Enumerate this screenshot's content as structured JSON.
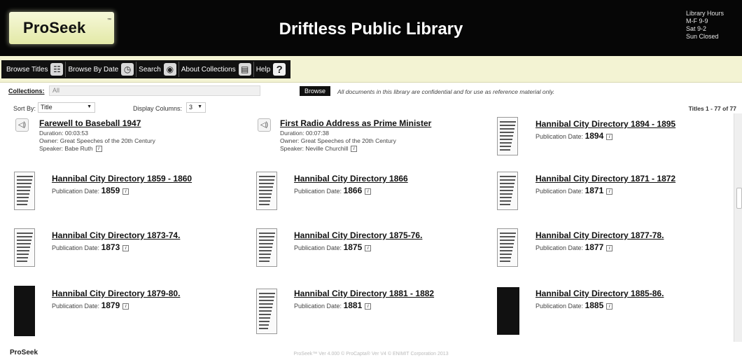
{
  "header": {
    "logo": "ProSeek",
    "logo_tm": "™",
    "title": "Driftless Public Library",
    "hours": [
      "Library Hours",
      "M-F 9-9",
      "Sat 9-2",
      "Sun Closed"
    ]
  },
  "menu": {
    "items": [
      {
        "label": "Browse Titles",
        "icon": "book-icon"
      },
      {
        "label": "Browse By Date",
        "icon": "calendar-icon"
      },
      {
        "label": "Search",
        "icon": "binoculars-icon"
      },
      {
        "label": "About Collections",
        "icon": "open-book-icon"
      },
      {
        "label": "Help",
        "icon": "question-icon"
      }
    ]
  },
  "collections": {
    "label": "Collections:",
    "value": "All",
    "browse_label": "Browse",
    "notice": "All documents in this library are confidential and for use as reference material only."
  },
  "sort": {
    "label": "Sort By:",
    "value": "Title",
    "columns_label": "Display Columns:",
    "columns_value": "3",
    "titles_count": "Titles 1 - 77 of 77"
  },
  "audio_items": [
    {
      "title": "Farewell to Baseball 1947",
      "duration": "Duration: 00:03:53",
      "owner": "Owner: Great Speeches of the 20th Century",
      "speaker": "Speaker: Babe Ruth"
    },
    {
      "title": "First Radio Address as Prime Minister",
      "duration": "Duration: 00:07:38",
      "owner": "Owner: Great Speeches of the 20th Century",
      "speaker": "Speaker: Neville Churchill"
    }
  ],
  "doc_items": [
    {
      "title": "Hannibal City Directory 1894 - 1895",
      "date_label": "Publication Date:",
      "year": "1894"
    },
    {
      "title": "Hannibal City Directory 1859 - 1860",
      "date_label": "Publication Date:",
      "year": "1859"
    },
    {
      "title": "Hannibal City Directory 1866",
      "date_label": "Publication Date:",
      "year": "1866"
    },
    {
      "title": "Hannibal City Directory 1871 - 1872",
      "date_label": "Publication Date:",
      "year": "1871"
    },
    {
      "title": "Hannibal City Directory 1873-74.",
      "date_label": "Publication Date:",
      "year": "1873"
    },
    {
      "title": "Hannibal City Directory 1875-76.",
      "date_label": "Publication Date:",
      "year": "1875"
    },
    {
      "title": "Hannibal City Directory 1877-78.",
      "date_label": "Publication Date:",
      "year": "1877"
    },
    {
      "title": "Hannibal City Directory 1879-80.",
      "date_label": "Publication Date:",
      "year": "1879"
    },
    {
      "title": "Hannibal City Directory 1881 - 1882",
      "date_label": "Publication Date:",
      "year": "1881"
    },
    {
      "title": "Hannibal City Directory 1885-86.",
      "date_label": "Publication Date:",
      "year": "1885"
    }
  ],
  "footer": {
    "logo": "ProSeek",
    "copyright": "ProSeek™ Ver 4.000 © ProCapta® Ver V4 © ENIMIT Corporation 2013"
  }
}
